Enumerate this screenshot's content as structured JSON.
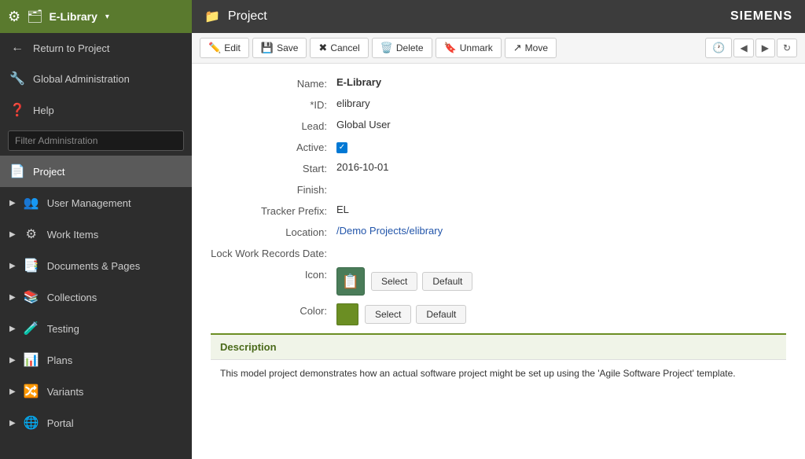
{
  "header": {
    "app_icon": "⚙",
    "app_doc_icon": "📋",
    "app_name": "E-Library",
    "app_dropdown": "▾",
    "page_icon": "📁",
    "page_title": "Project",
    "brand": "SIEMENS"
  },
  "sidebar": {
    "search_placeholder": "Filter Administration",
    "items": [
      {
        "id": "return-to-project",
        "icon": "←",
        "label": "Return to Project",
        "arrow": ""
      },
      {
        "id": "global-administration",
        "icon": "🔧",
        "label": "Global Administration",
        "arrow": ""
      },
      {
        "id": "help",
        "icon": "❓",
        "label": "Help",
        "arrow": ""
      },
      {
        "id": "project",
        "icon": "📄",
        "label": "Project",
        "arrow": "",
        "active": true
      },
      {
        "id": "user-management",
        "icon": "👥",
        "label": "User Management",
        "arrow": "▶"
      },
      {
        "id": "work-items",
        "icon": "⚙",
        "label": "Work Items",
        "arrow": "▶"
      },
      {
        "id": "documents-pages",
        "icon": "📑",
        "label": "Documents & Pages",
        "arrow": "▶"
      },
      {
        "id": "collections",
        "icon": "📚",
        "label": "Collections",
        "arrow": "▶"
      },
      {
        "id": "testing",
        "icon": "🧪",
        "label": "Testing",
        "arrow": "▶"
      },
      {
        "id": "plans",
        "icon": "📊",
        "label": "Plans",
        "arrow": "▶"
      },
      {
        "id": "variants",
        "icon": "🔀",
        "label": "Variants",
        "arrow": "▶"
      },
      {
        "id": "portal",
        "icon": "🌐",
        "label": "Portal",
        "arrow": "▶"
      }
    ]
  },
  "toolbar": {
    "edit_label": "Edit",
    "save_label": "Save",
    "cancel_label": "Cancel",
    "delete_label": "Delete",
    "unmark_label": "Unmark",
    "move_label": "Move"
  },
  "form": {
    "name_label": "Name:",
    "name_value": "E-Library",
    "id_label": "*ID:",
    "id_value": "elibrary",
    "lead_label": "Lead:",
    "lead_value": "Global User",
    "active_label": "Active:",
    "start_label": "Start:",
    "start_value": "2016-10-01",
    "finish_label": "Finish:",
    "finish_value": "",
    "tracker_prefix_label": "Tracker Prefix:",
    "tracker_prefix_value": "EL",
    "location_label": "Location:",
    "location_value": "/Demo Projects/elibrary",
    "lock_label": "Lock Work Records Date:",
    "icon_label": "Icon:",
    "icon_select": "Select",
    "icon_default": "Default",
    "color_label": "Color:",
    "color_select": "Select",
    "color_default": "Default",
    "description_heading": "Description",
    "description_text": "This model project demonstrates how an actual software project might be set up using the 'Agile Software Project' template."
  }
}
